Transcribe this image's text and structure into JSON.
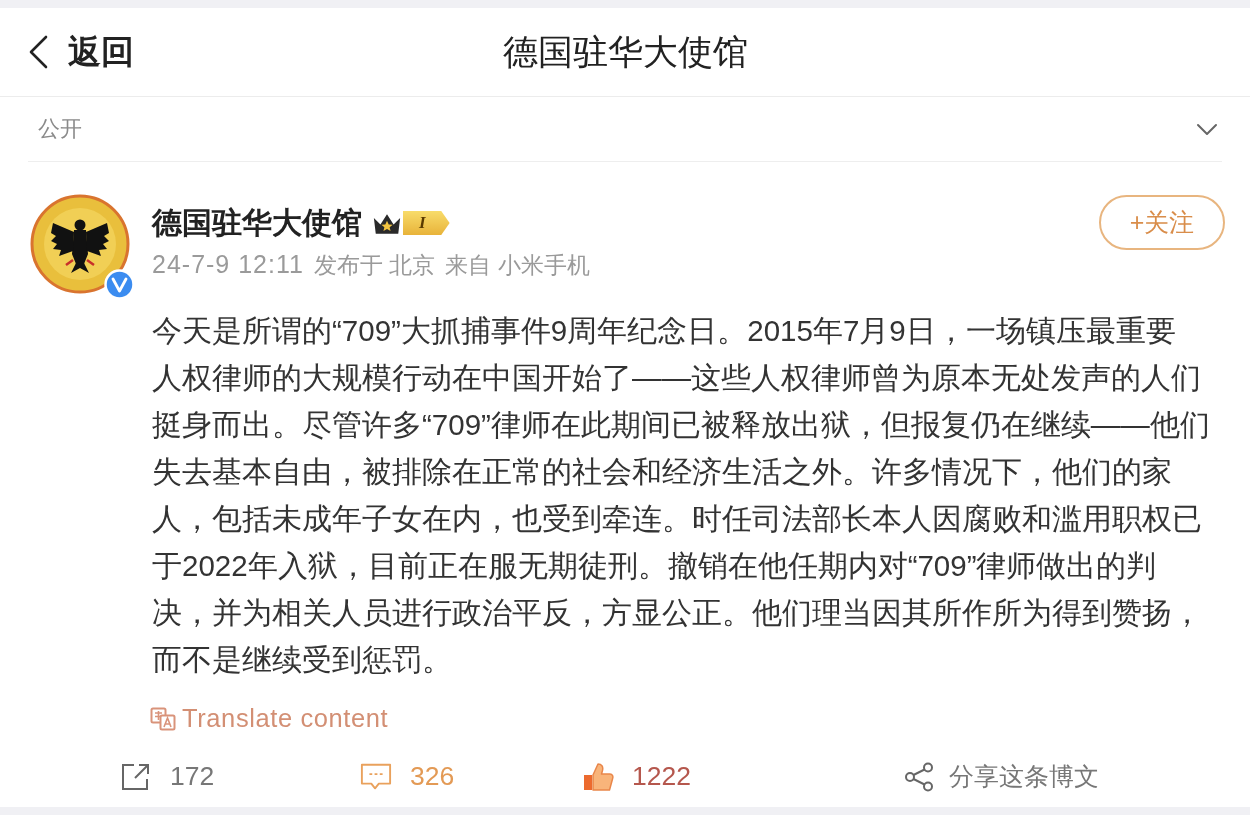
{
  "nav": {
    "back_label": "返回",
    "title": "德国驻华大使馆"
  },
  "visibility": {
    "label": "公开",
    "expanded": false
  },
  "post": {
    "author": {
      "name": "德国驻华大使馆",
      "verified": true,
      "vip_level": "I"
    },
    "meta": {
      "time": "24-7-9 12:11",
      "location": "发布于 北京",
      "source": "来自 小米手机"
    },
    "follow": {
      "label": "+关注",
      "following": false
    },
    "text_lines": [
      "今天是所谓的“709”大抓捕事件9周年纪念日。2015年7月9日，一场镇压最重要",
      "人权律师的大规模行动在中国开始了——这些人权律师曾为原本无处发声的人们",
      "挺身而出。尽管许多“709”律师在此期间已被释放出狱，但报复仍在继续——他们",
      "失去基本自由，被排除在正常的社会和经济生活之外。许多情况下，他们的家",
      "人，包括未成年子女在内，也受到牵连。时任司法部长本人因腐败和滥用职权已",
      "于2022年入狱，目前正在服无期徒刑。撤销在他任期内对“709”律师做出的判",
      "决，并为相关人员进行政治平反，方显公正。他们理当因其所作所为得到赞扬，",
      "而不是继续受到惩罚。"
    ],
    "translate": "Translate content",
    "actions": [
      {
        "kind": "repost",
        "label": "172",
        "active": false
      },
      {
        "kind": "comment",
        "label": "326",
        "active": true
      },
      {
        "kind": "like",
        "label": "1222",
        "active": true
      },
      {
        "kind": "share",
        "label": "分享这条博文",
        "active": false
      }
    ]
  }
}
